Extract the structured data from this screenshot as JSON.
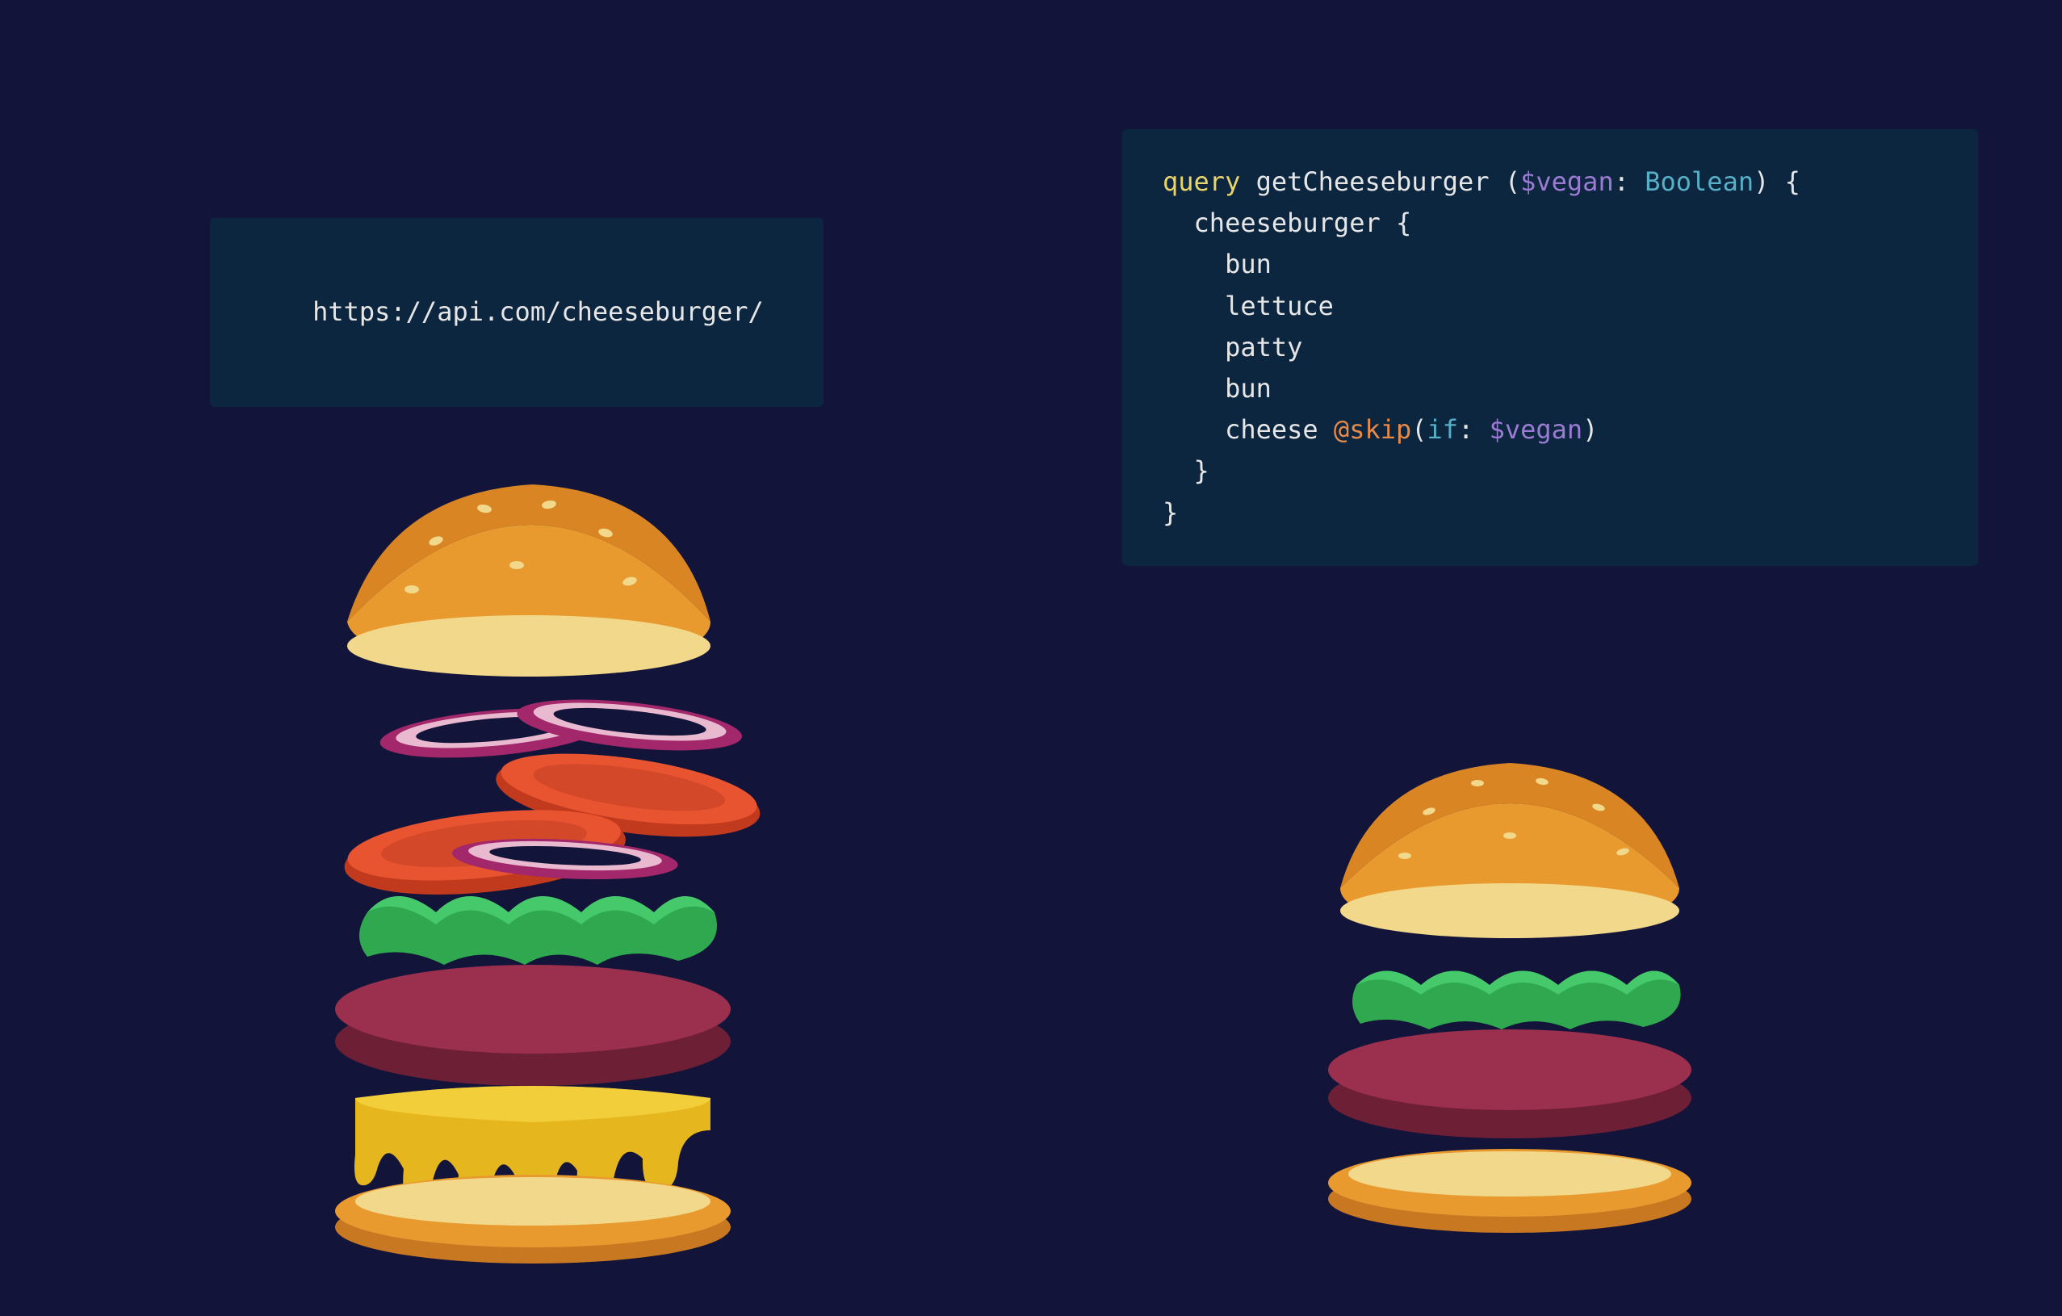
{
  "rest": {
    "url": "https://api.com/cheeseburger/"
  },
  "graphql": {
    "keyword": "query",
    "operation": "getCheeseburger",
    "variable": "$vegan",
    "variable_type": "Boolean",
    "root_field": "cheeseburger",
    "fields": [
      "bun",
      "lettuce",
      "patty",
      "bun"
    ],
    "directive_field": "cheese",
    "directive": "@skip",
    "directive_arg_key": "if",
    "directive_arg_val": "$vegan"
  },
  "illustrations": {
    "left_burger_layers": [
      "top-bun",
      "onion",
      "onion",
      "tomato",
      "tomato",
      "onion",
      "lettuce",
      "patty",
      "cheese",
      "bottom-bun"
    ],
    "right_burger_layers": [
      "top-bun",
      "lettuce",
      "patty",
      "bottom-bun"
    ]
  }
}
